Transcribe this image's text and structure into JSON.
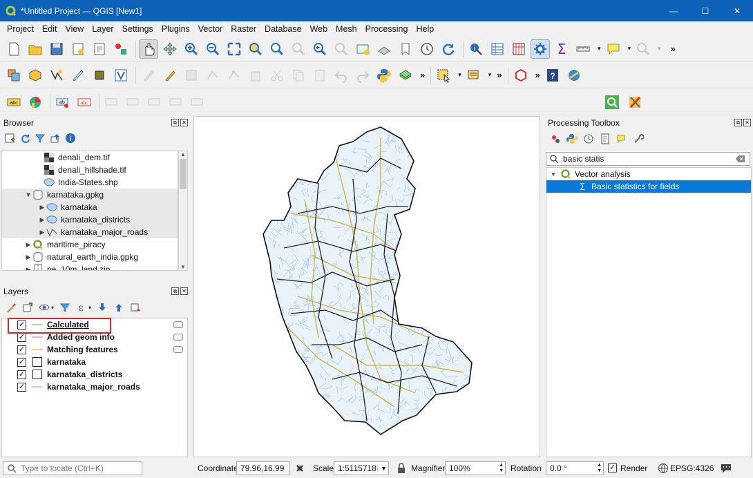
{
  "window": {
    "title": "*Untitled Project — QGIS [New1]",
    "controls": {
      "minimize": "—",
      "maximize": "☐",
      "close": "✕"
    }
  },
  "menu": [
    "Project",
    "Edit",
    "View",
    "Layer",
    "Settings",
    "Plugins",
    "Vector",
    "Raster",
    "Database",
    "Web",
    "Mesh",
    "Processing",
    "Help"
  ],
  "browser": {
    "title": "Browser",
    "items": [
      {
        "label": "denali_dem.tif",
        "type": "raster",
        "indent": 60,
        "arrow": ""
      },
      {
        "label": "denali_hillshade.tif",
        "type": "raster",
        "indent": 60,
        "arrow": ""
      },
      {
        "label": "India-States.shp",
        "type": "polygon",
        "indent": 60,
        "arrow": ""
      },
      {
        "label": "karnataka.gpkg",
        "type": "geopackage",
        "indent": 44,
        "arrow": "▼"
      },
      {
        "label": "karnataka",
        "type": "polygon",
        "indent": 64,
        "arrow": "▶"
      },
      {
        "label": "karnataka_districts",
        "type": "polygon",
        "indent": 64,
        "arrow": "▶"
      },
      {
        "label": "karnataka_major_roads",
        "type": "line",
        "indent": 64,
        "arrow": "▶"
      },
      {
        "label": "maritime_piracy",
        "type": "qgis",
        "indent": 44,
        "arrow": "▶"
      },
      {
        "label": "natural_earth_india.gpkg",
        "type": "geopackage",
        "indent": 44,
        "arrow": "▶"
      },
      {
        "label": "ne_10m_land.zip",
        "type": "zip",
        "indent": 44,
        "arrow": "▶"
      }
    ]
  },
  "layers": {
    "title": "Layers",
    "items": [
      {
        "label": "Calculated",
        "checked": true,
        "symbol": "line",
        "color": "#8fd18f",
        "underline": true,
        "edit": true
      },
      {
        "label": "Added geom info",
        "checked": true,
        "symbol": "line",
        "color": "#e89aa0",
        "edit": true
      },
      {
        "label": "Matching features",
        "checked": true,
        "symbol": "line",
        "color": "#e3c24a",
        "edit": true
      },
      {
        "label": "karnataka",
        "checked": true,
        "symbol": "poly",
        "color": "#ffffff",
        "edit": false
      },
      {
        "label": "karnataka_districts",
        "checked": true,
        "symbol": "poly",
        "color": "#ffffff",
        "edit": false
      },
      {
        "label": "karnataka_major_roads",
        "checked": true,
        "symbol": "line",
        "color": "#a9c7e0",
        "edit": false
      }
    ],
    "highlight_color": "#e0242a"
  },
  "toolbox": {
    "title": "Processing Toolbox",
    "search_value": "basic statis",
    "group": "Vector analysis",
    "algorithm": "Basic statistics for fields",
    "selection_color": "#0a78d7"
  },
  "status": {
    "locate_placeholder": "Type to locate (Ctrl+K)",
    "coordinate_label": "Coordinate",
    "coordinate_value": "79.96,16.99",
    "scale_label": "Scale",
    "scale_value": "1:5115718",
    "magnifier_label": "Magnifier",
    "magnifier_value": "100%",
    "rotation_label": "Rotation",
    "rotation_value": "0.0 °",
    "render_label": "Render",
    "crs": "EPSG:4326"
  },
  "map": {
    "district_color": "#222222",
    "roads_color": "#a9c7e0",
    "major_color": "#c8b84a"
  }
}
